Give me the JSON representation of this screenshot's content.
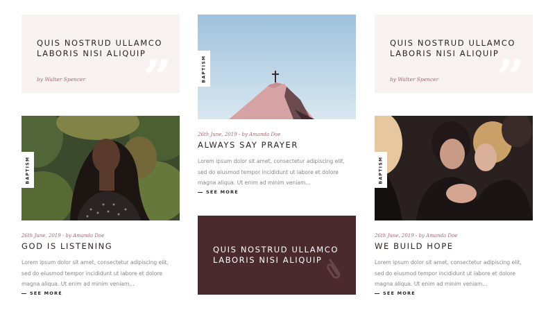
{
  "quotes": [
    {
      "title": "Quis nostrud ullamco laboris nisi aliquip",
      "byline": "by Walter Spencer"
    },
    {
      "title": "Quis nostrud ullamco laboris nisi aliquip",
      "byline": "by Walter Spencer"
    },
    {
      "title": "Quis nostrud ullamco laboris nisi aliquip"
    }
  ],
  "quote_glyph": "”",
  "posts": [
    {
      "tag": "BAPTISM",
      "meta": "26th June, 2019 - by Amanda Doe",
      "title": "Always say prayer",
      "excerpt": "Lorem ipsum dolor sit amet, consectetur adipiscing elit, sed do eiusmod tempor incididunt ut labore et dolore magna aliqua. Ut enim ad minim veniam...",
      "cta": "SEE MORE"
    },
    {
      "tag": "BAPTISM",
      "meta": "26th June, 2019 - by Amanda Doe",
      "title": "God is listening",
      "excerpt": "Lorem ipsum dolor sit amet, consectetur adipiscing elit, sed do eiusmod tempor incididunt ut labore et dolore magna aliqua. Ut enim ad minim veniam...",
      "cta": "SEE MORE"
    },
    {
      "tag": "BAPTISM",
      "meta": "26th June, 2019 - by Amanda Doe",
      "title": "We build hope",
      "excerpt": "Lorem ipsum dolor sit amet, consectetur adipiscing elit, sed do eiusmod tempor incididunt ut labore et dolore magna aliqua. Ut enim ad minim veniam...",
      "cta": "SEE MORE"
    }
  ],
  "colors": {
    "quote_bg": "#f8f3f1",
    "dark_card_bg": "#4a2a2d",
    "accent": "#a7656b",
    "text_dark": "#2b1e1f",
    "text_muted": "#8c8384"
  },
  "icons": {
    "quote": "closing-quote-icon",
    "link": "paperclip-icon",
    "cross": "cross-icon"
  }
}
